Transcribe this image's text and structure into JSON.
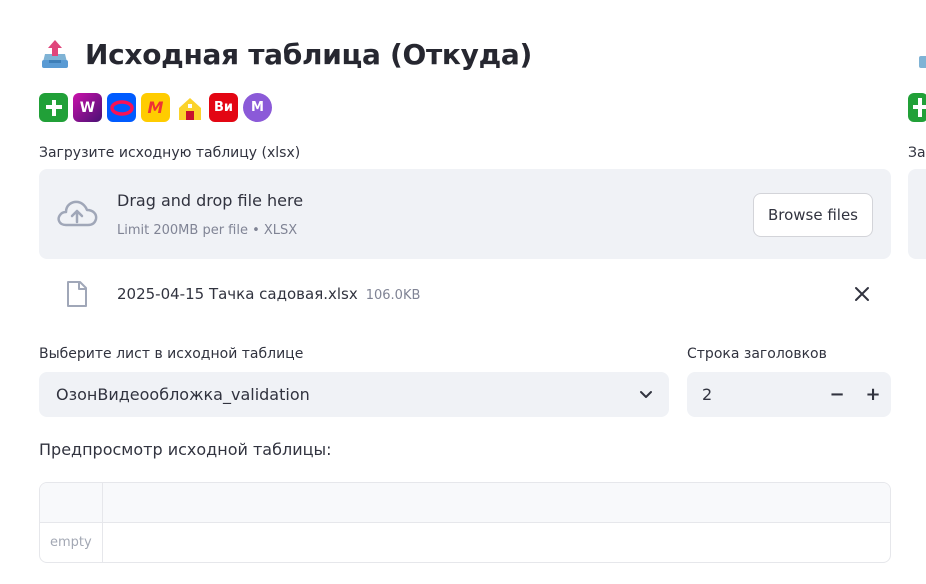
{
  "header": {
    "title": "Исходная таблица (Откуда)",
    "title_icon": "inbox-tray-upload-icon"
  },
  "marketplaces": [
    {
      "name": "plus-green",
      "label": "",
      "color": "#21a038"
    },
    {
      "name": "wildberries",
      "label": "W",
      "color": "#8a1fb0"
    },
    {
      "name": "ozon",
      "label": "",
      "color": "#005bff"
    },
    {
      "name": "yandex-market",
      "label": "M",
      "color": "#ffcc00"
    },
    {
      "name": "home-yellow",
      "label": "",
      "color": "#fbd32b"
    },
    {
      "name": "vseinstrumenti",
      "label": "Ви",
      "color": "#e30613"
    },
    {
      "name": "megamarket",
      "label": "M",
      "color": "#8b5ad8"
    }
  ],
  "uploader": {
    "label": "Загрузите исходную таблицу (xlsx)",
    "drop_text": "Drag and drop file here",
    "limit_text": "Limit 200MB per file • XLSX",
    "browse_label": "Browse files"
  },
  "uploaded_file": {
    "name": "2025-04-15 Тачка садовая.xlsx",
    "size": "106.0KB"
  },
  "sheet_select": {
    "label": "Выберите лист в исходной таблице",
    "value": "ОзонВидеообложка_validation"
  },
  "header_row": {
    "label": "Строка заголовков",
    "value": "2",
    "minus": "−",
    "plus": "+"
  },
  "preview": {
    "label": "Предпросмотр исходной таблицы:",
    "empty_text": "empty"
  },
  "right_column": {
    "label_fragment": "Заг"
  }
}
